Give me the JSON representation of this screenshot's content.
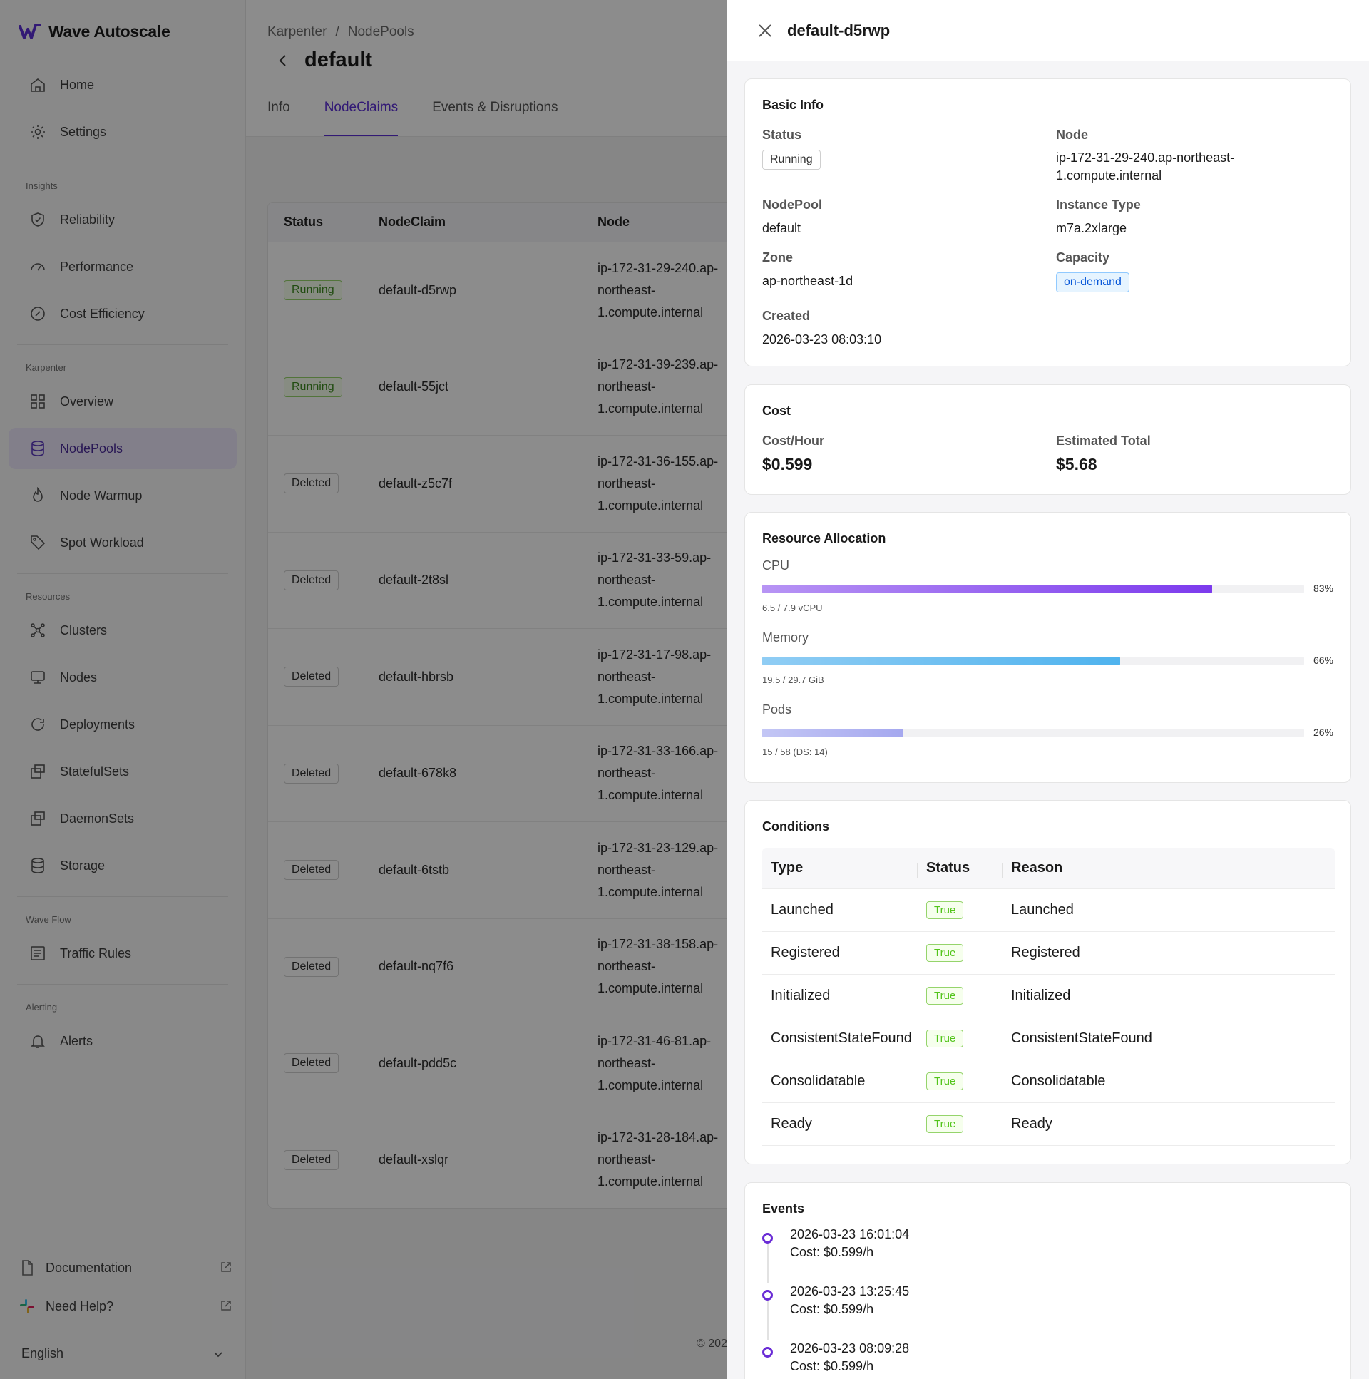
{
  "brand": {
    "name": "Wave Autoscale"
  },
  "sidebar": {
    "top_items": [
      {
        "label": "Home",
        "icon": "home-icon"
      },
      {
        "label": "Settings",
        "icon": "gear-icon"
      }
    ],
    "sections": [
      {
        "label": "Insights",
        "items": [
          {
            "label": "Reliability",
            "icon": "shield-icon"
          },
          {
            "label": "Performance",
            "icon": "gauge-icon"
          },
          {
            "label": "Cost Efficiency",
            "icon": "coin-icon"
          }
        ]
      },
      {
        "label": "Karpenter",
        "items": [
          {
            "label": "Overview",
            "icon": "grid-icon"
          },
          {
            "label": "NodePools",
            "icon": "database-icon",
            "active": true
          },
          {
            "label": "Node Warmup",
            "icon": "flame-icon"
          },
          {
            "label": "Spot Workload",
            "icon": "tag-icon"
          }
        ]
      },
      {
        "label": "Resources",
        "items": [
          {
            "label": "Clusters",
            "icon": "cluster-icon"
          },
          {
            "label": "Nodes",
            "icon": "server-icon"
          },
          {
            "label": "Deployments",
            "icon": "refresh-icon"
          },
          {
            "label": "StatefulSets",
            "icon": "stack-icon"
          },
          {
            "label": "DaemonSets",
            "icon": "stack-icon"
          },
          {
            "label": "Storage",
            "icon": "database-icon"
          }
        ]
      },
      {
        "label": "Wave Flow",
        "items": [
          {
            "label": "Traffic Rules",
            "icon": "rules-icon"
          }
        ]
      },
      {
        "label": "Alerting",
        "items": [
          {
            "label": "Alerts",
            "icon": "bell-icon"
          }
        ]
      }
    ],
    "documentation": "Documentation",
    "need_help": "Need Help?",
    "language": "English"
  },
  "main": {
    "breadcrumb": {
      "parent": "Karpenter",
      "separator": "/",
      "current": "NodePools"
    },
    "title": "default",
    "tabs": [
      "Info",
      "NodeClaims",
      "Events & Disruptions"
    ],
    "active_tab": "NodeClaims",
    "table": {
      "columns": [
        "Status",
        "NodeClaim",
        "Node"
      ],
      "rows": [
        {
          "status": "Running",
          "claim": "default-d5rwp",
          "node": [
            "ip-172-31-29-240.ap-",
            "northeast-",
            "1.compute.internal"
          ]
        },
        {
          "status": "Running",
          "claim": "default-55jct",
          "node": [
            "ip-172-31-39-239.ap-",
            "northeast-",
            "1.compute.internal"
          ]
        },
        {
          "status": "Deleted",
          "claim": "default-z5c7f",
          "node": [
            "ip-172-31-36-155.ap-",
            "northeast-",
            "1.compute.internal"
          ]
        },
        {
          "status": "Deleted",
          "claim": "default-2t8sl",
          "node": [
            "ip-172-31-33-59.ap-",
            "northeast-",
            "1.compute.internal"
          ]
        },
        {
          "status": "Deleted",
          "claim": "default-hbrsb",
          "node": [
            "ip-172-31-17-98.ap-",
            "northeast-",
            "1.compute.internal"
          ]
        },
        {
          "status": "Deleted",
          "claim": "default-678k8",
          "node": [
            "ip-172-31-33-166.ap-",
            "northeast-",
            "1.compute.internal"
          ]
        },
        {
          "status": "Deleted",
          "claim": "default-6tstb",
          "node": [
            "ip-172-31-23-129.ap-",
            "northeast-",
            "1.compute.internal"
          ]
        },
        {
          "status": "Deleted",
          "claim": "default-nq7f6",
          "node": [
            "ip-172-31-38-158.ap-",
            "northeast-",
            "1.compute.internal"
          ]
        },
        {
          "status": "Deleted",
          "claim": "default-pdd5c",
          "node": [
            "ip-172-31-46-81.ap-",
            "northeast-",
            "1.compute.internal"
          ]
        },
        {
          "status": "Deleted",
          "claim": "default-xslqr",
          "node": [
            "ip-172-31-28-184.ap-",
            "northeast-",
            "1.compute.internal"
          ]
        }
      ]
    },
    "footer": "© 202"
  },
  "drawer": {
    "title": "default-d5rwp",
    "basic_info": {
      "title": "Basic Info",
      "status_label": "Status",
      "status": "Running",
      "node_label": "Node",
      "node_line1": "ip-172-31-29-240.ap-northeast-",
      "node_line2": "1.compute.internal",
      "nodepool_label": "NodePool",
      "nodepool": "default",
      "instance_type_label": "Instance Type",
      "instance_type": "m7a.2xlarge",
      "zone_label": "Zone",
      "zone": "ap-northeast-1d",
      "capacity_label": "Capacity",
      "capacity": "on-demand",
      "created_label": "Created",
      "created": "2026-03-23 08:03:10"
    },
    "cost": {
      "title": "Cost",
      "per_hour_label": "Cost/Hour",
      "per_hour": "$0.599",
      "total_label": "Estimated Total",
      "total": "$5.68"
    },
    "resources": {
      "title": "Resource Allocation",
      "items": [
        {
          "label": "CPU",
          "percent": 83,
          "percent_text": "83%",
          "detail": "6.5 / 7.9 vCPU",
          "color_from": "#b794f4",
          "color_to": "#7c3aed"
        },
        {
          "label": "Memory",
          "percent": 66,
          "percent_text": "66%",
          "detail": "19.5 / 29.7 GiB",
          "color_from": "#90cdf4",
          "color_to": "#4fb3ee"
        },
        {
          "label": "Pods",
          "percent": 26,
          "percent_text": "26%",
          "detail": "15 / 58 (DS: 14)",
          "color_from": "#c3c6f5",
          "color_to": "#a5a8ef"
        }
      ]
    },
    "conditions": {
      "title": "Conditions",
      "columns": [
        "Type",
        "Status",
        "Reason"
      ],
      "rows": [
        {
          "type": "Launched",
          "status": "True",
          "reason": "Launched"
        },
        {
          "type": "Registered",
          "status": "True",
          "reason": "Registered"
        },
        {
          "type": "Initialized",
          "status": "True",
          "reason": "Initialized"
        },
        {
          "type": "ConsistentStateFound",
          "status": "True",
          "reason": "ConsistentStateFound"
        },
        {
          "type": "Consolidatable",
          "status": "True",
          "reason": "Consolidatable"
        },
        {
          "type": "Ready",
          "status": "True",
          "reason": "Ready"
        }
      ]
    },
    "events": {
      "title": "Events",
      "items": [
        {
          "time": "2026-03-23 16:01:04",
          "text": "Cost: $0.599/h"
        },
        {
          "time": "2026-03-23 13:25:45",
          "text": "Cost: $0.599/h"
        },
        {
          "time": "2026-03-23 08:09:28",
          "text": "Cost: $0.599/h"
        }
      ]
    }
  }
}
